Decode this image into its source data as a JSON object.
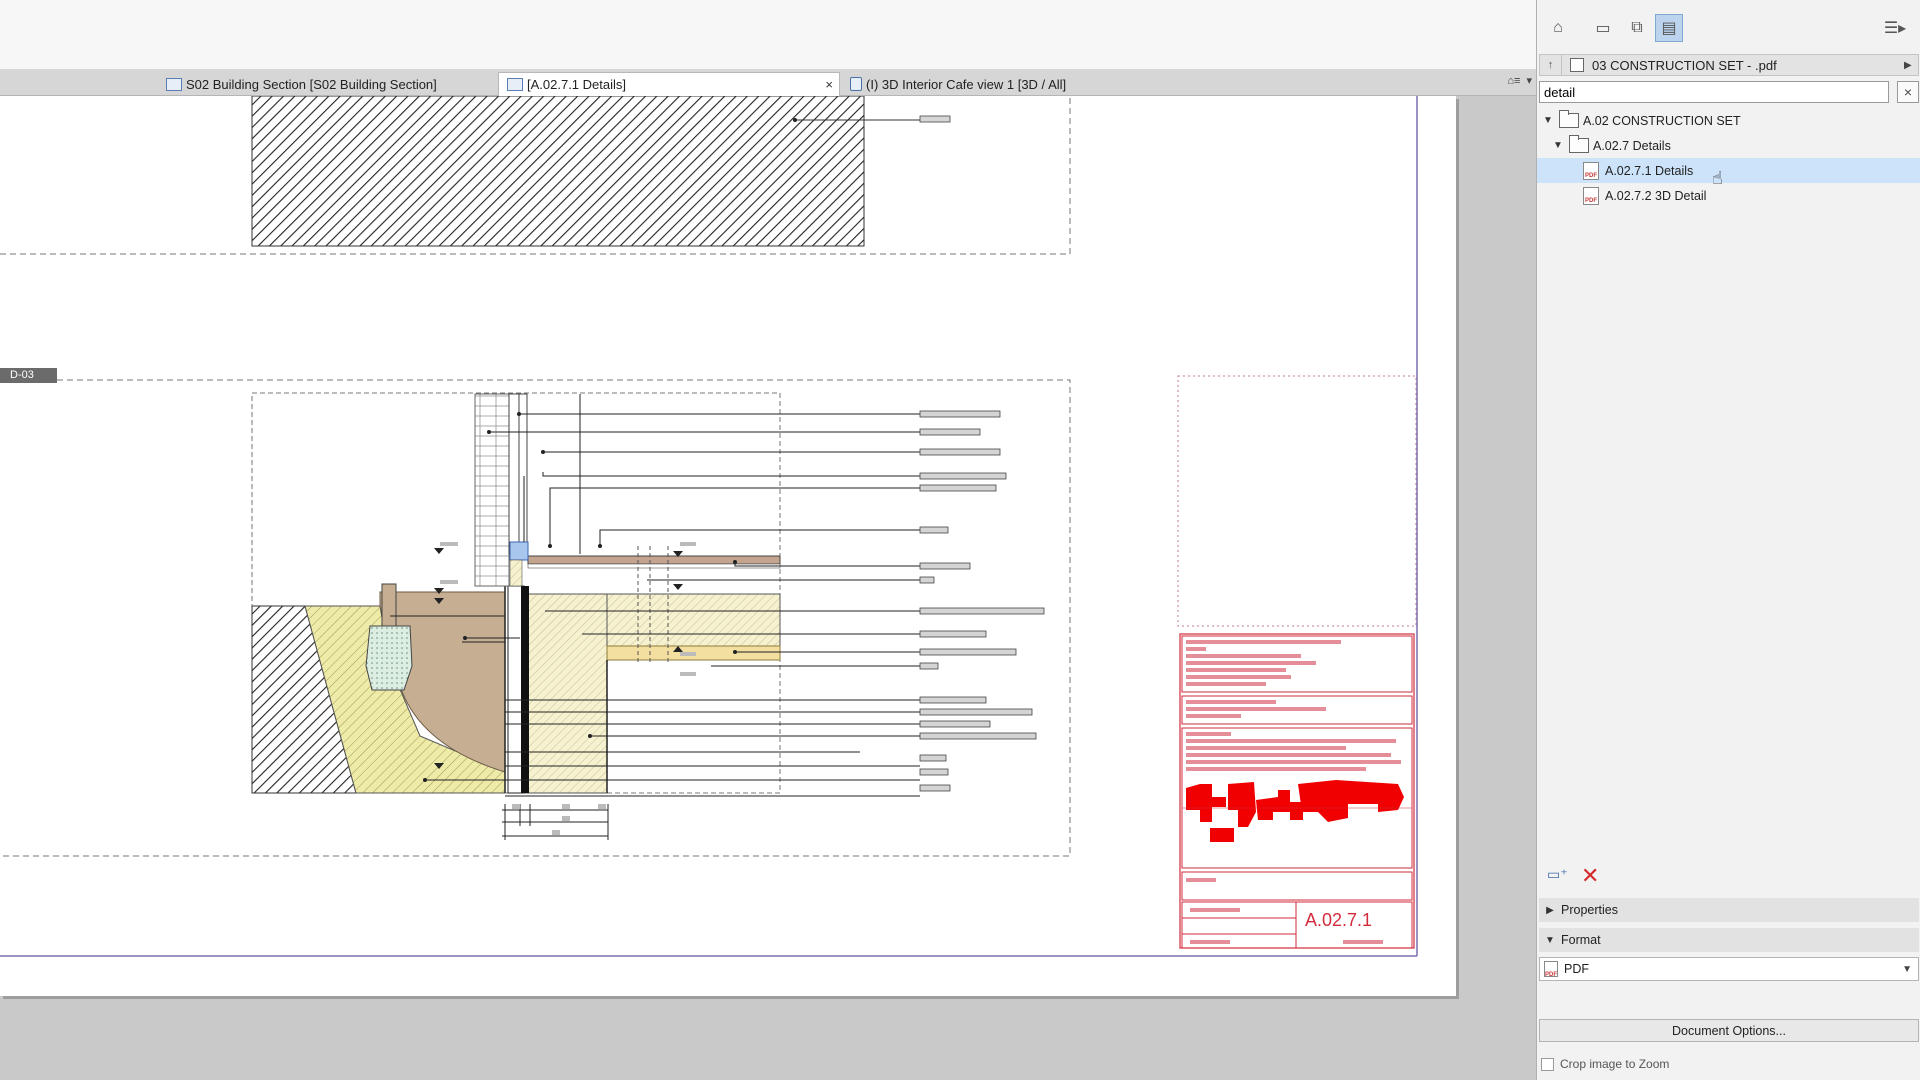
{
  "tabs": [
    {
      "label": "S02 Building Section [S02 Building Section]",
      "active": false
    },
    {
      "label": "[A.02.7.1 Details]",
      "active": true
    },
    {
      "label": "(I) 3D Interior Cafe view 1 [3D / All]",
      "active": false
    }
  ],
  "tab_close_glyph": "×",
  "canvas": {
    "drawing_label": "D-03",
    "sheet_number": "A.02.7.1"
  },
  "panel": {
    "set_name": "03 CONSTRUCTION SET - .pdf",
    "search_value": "detail",
    "search_clear_glyph": "×",
    "tree": [
      {
        "label": "A.02 CONSTRUCTION SET",
        "type": "folder",
        "level": 0,
        "expanded": true
      },
      {
        "label": "A.02.7 Details",
        "type": "folder",
        "level": 1,
        "expanded": true
      },
      {
        "label": "A.02.7.1 Details",
        "type": "pdf",
        "level": 2,
        "selected": true
      },
      {
        "label": "A.02.7.2 3D Detail",
        "type": "pdf",
        "level": 2,
        "selected": false
      }
    ],
    "properties_label": "Properties",
    "format_label": "Format",
    "format_value": "PDF",
    "document_options_label": "Document Options...",
    "crop_label": "Crop image to Zoom",
    "pdf_icon_text": "PDF"
  },
  "colors": {
    "accent_selection": "#cde3fa",
    "titleblock_red": "#d22c3c",
    "delete_red": "#d52a2a"
  },
  "icons": [
    "home-icon",
    "layout-icon",
    "folder-icon",
    "publisher-icon",
    "menu-icon",
    "up-icon",
    "new-folder-icon",
    "delete-icon"
  ]
}
